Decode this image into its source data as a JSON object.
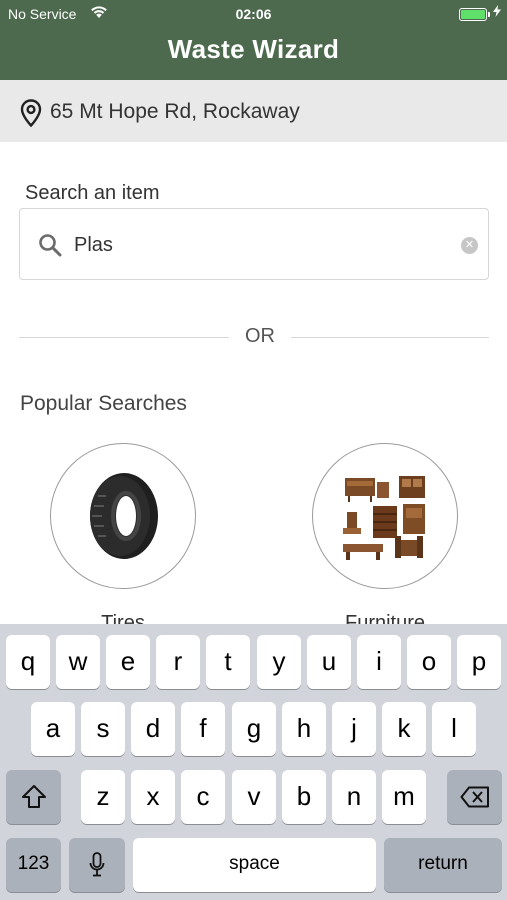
{
  "status_bar": {
    "carrier": "No Service",
    "time": "02:06"
  },
  "nav": {
    "title": "Waste Wizard"
  },
  "address": {
    "text": "65 Mt Hope Rd, Rockaway",
    "icon": "location-pin-icon"
  },
  "search": {
    "label": "Search an item",
    "value": "Plas",
    "icon": "search-icon",
    "clear_icon": "clear-icon"
  },
  "divider_text": "OR",
  "popular": {
    "heading": "Popular Searches",
    "items": [
      {
        "label": "Tires",
        "icon": "tire-icon"
      },
      {
        "label": "Furniture",
        "icon": "furniture-icon"
      }
    ]
  },
  "keyboard": {
    "row1": [
      "q",
      "w",
      "e",
      "r",
      "t",
      "y",
      "u",
      "i",
      "o",
      "p"
    ],
    "row2": [
      "a",
      "s",
      "d",
      "f",
      "g",
      "h",
      "j",
      "k",
      "l"
    ],
    "row3": [
      "z",
      "x",
      "c",
      "v",
      "b",
      "n",
      "m"
    ],
    "numbers_label": "123",
    "space_label": "space",
    "return_label": "return",
    "shift_icon": "shift-icon",
    "delete_icon": "delete-icon",
    "mic_icon": "microphone-icon"
  },
  "colors": {
    "nav_bg": "#4d6a4e",
    "address_bg": "#e9e9e9",
    "keyboard_bg": "#d1d4da",
    "battery": "#5fe06a"
  }
}
